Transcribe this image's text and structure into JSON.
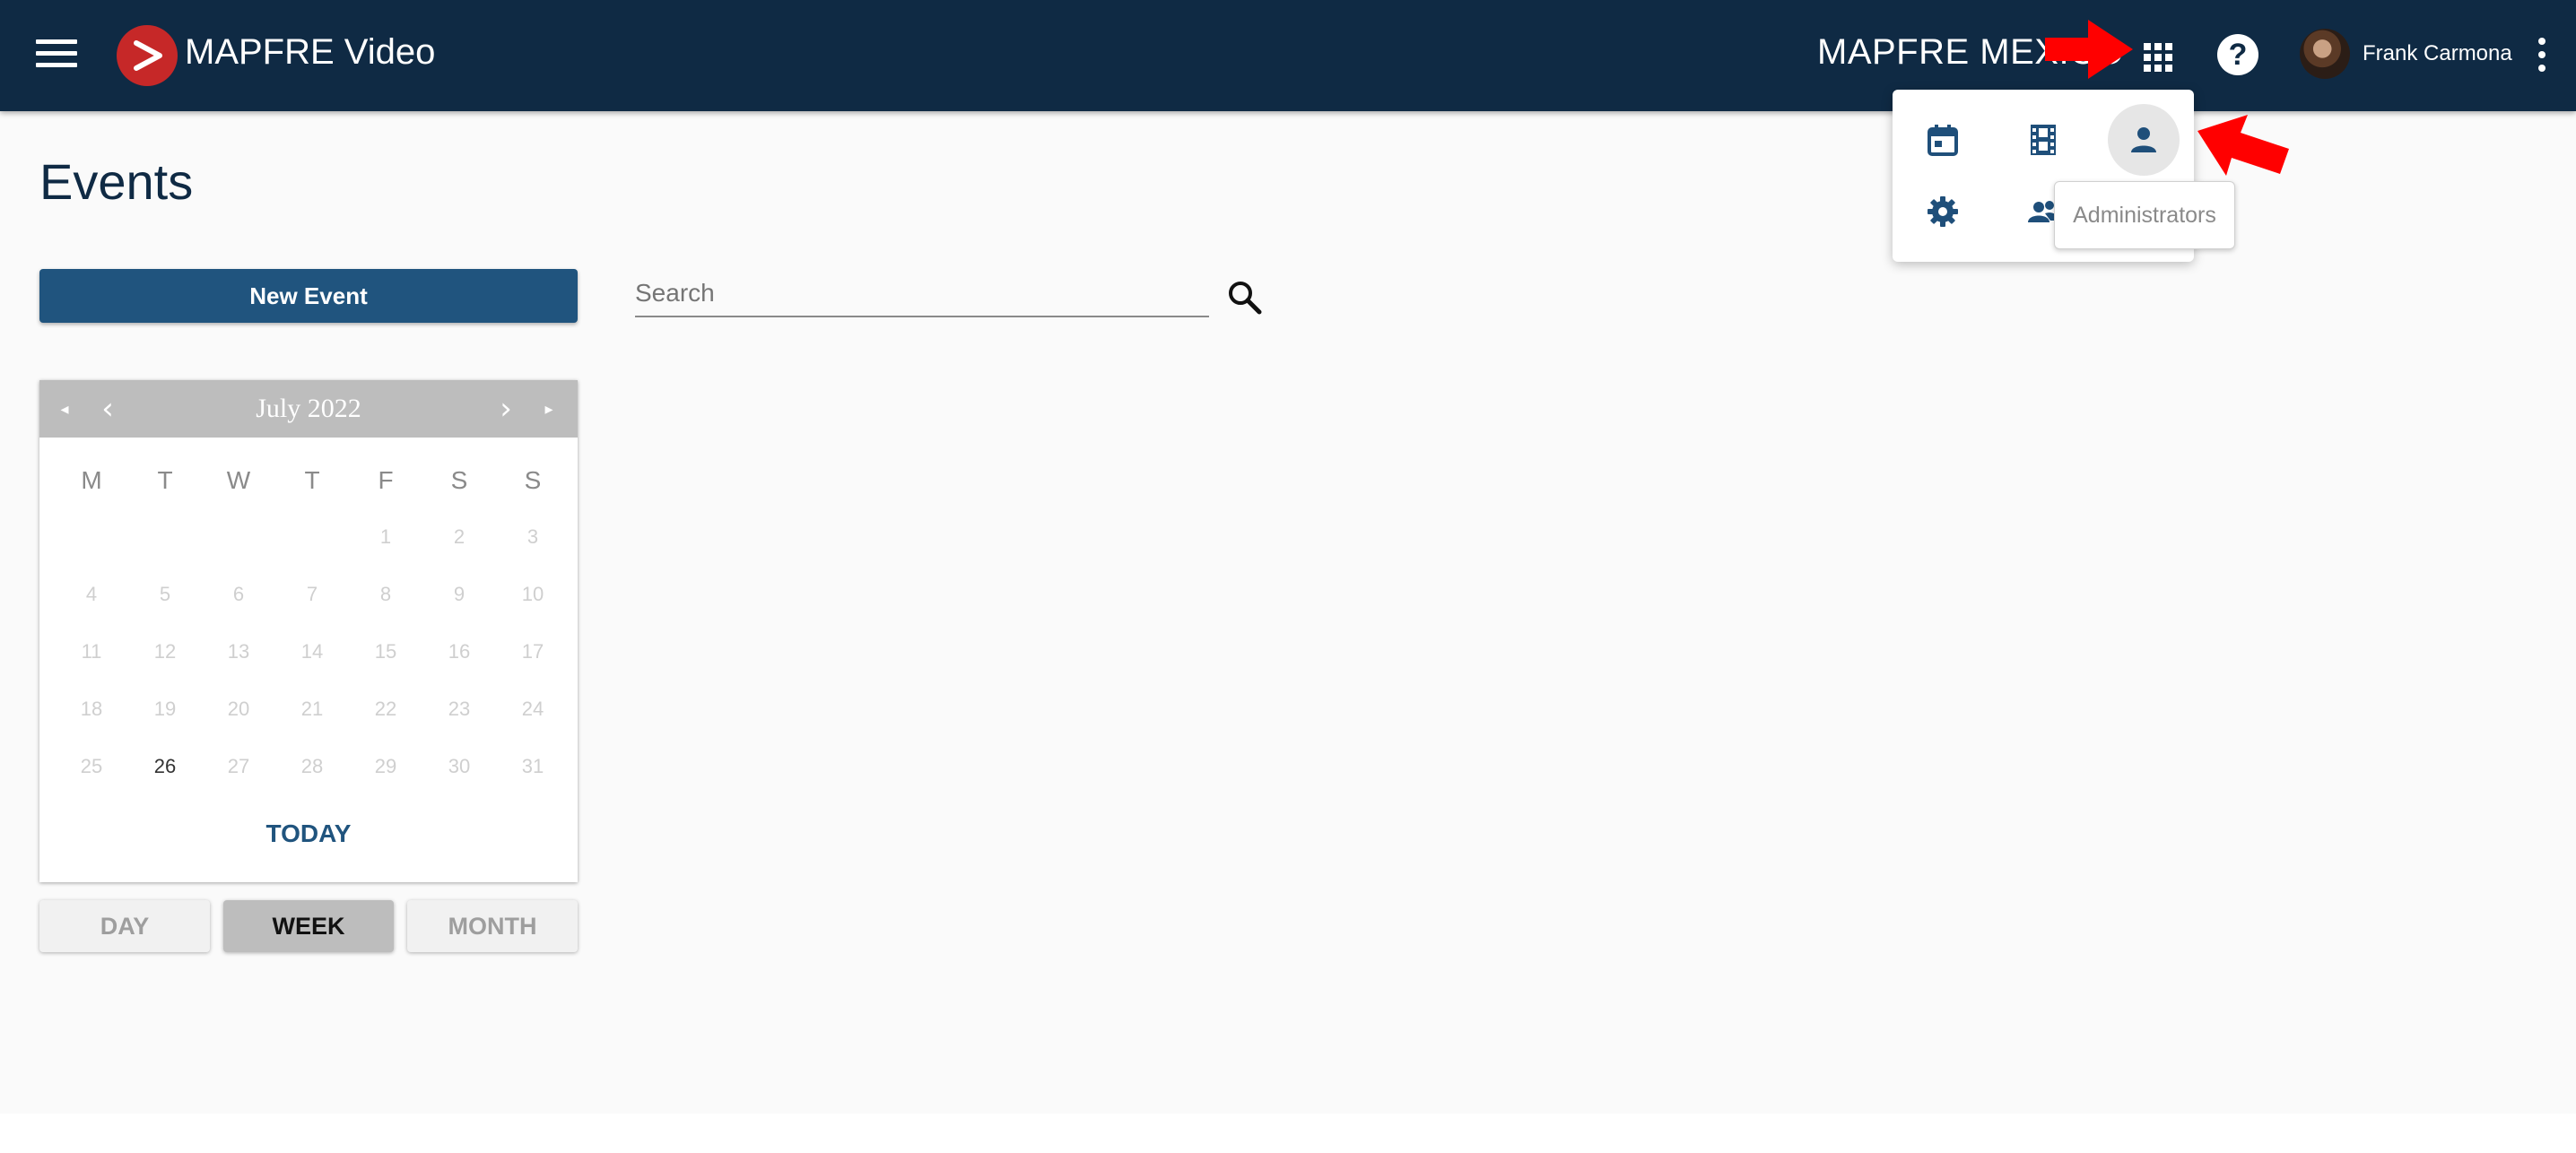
{
  "header": {
    "app_name": "MAPFRE Video",
    "org_name": "MAPFRE MEXICO",
    "user_name": "Frank Carmona",
    "icons": [
      "menu-icon",
      "mapfre-logo",
      "apps-grid-icon",
      "help-icon",
      "avatar",
      "more-vert-icon"
    ]
  },
  "page": {
    "title": "Events",
    "new_event_label": "New Event",
    "search_placeholder": "Search"
  },
  "calendar": {
    "month_label": "July 2022",
    "nav": {
      "prev_year": "◂",
      "prev": "‹",
      "next": "›",
      "next_year": "▸"
    },
    "weekdays": [
      "M",
      "T",
      "W",
      "T",
      "F",
      "S",
      "S"
    ],
    "weeks": [
      [
        "",
        "",
        "",
        "",
        "1",
        "2",
        "3"
      ],
      [
        "4",
        "5",
        "6",
        "7",
        "8",
        "9",
        "10"
      ],
      [
        "11",
        "12",
        "13",
        "14",
        "15",
        "16",
        "17"
      ],
      [
        "18",
        "19",
        "20",
        "21",
        "22",
        "23",
        "24"
      ],
      [
        "25",
        "26",
        "27",
        "28",
        "29",
        "30",
        "31"
      ]
    ],
    "current_day": "26",
    "today_label": "TODAY"
  },
  "views": {
    "day": "DAY",
    "week": "WEEK",
    "month": "MONTH",
    "active": "WEEK"
  },
  "apps_menu": {
    "items": [
      "calendar-icon",
      "film-icon",
      "person-icon",
      "settings-icon",
      "group-icon"
    ],
    "hovered": "person-icon",
    "tooltip": "Administrators"
  },
  "colors": {
    "header_bg": "#0f2a44",
    "primary": "#20547e",
    "logo_red": "#c62828",
    "annotation_red": "#ff0000"
  }
}
